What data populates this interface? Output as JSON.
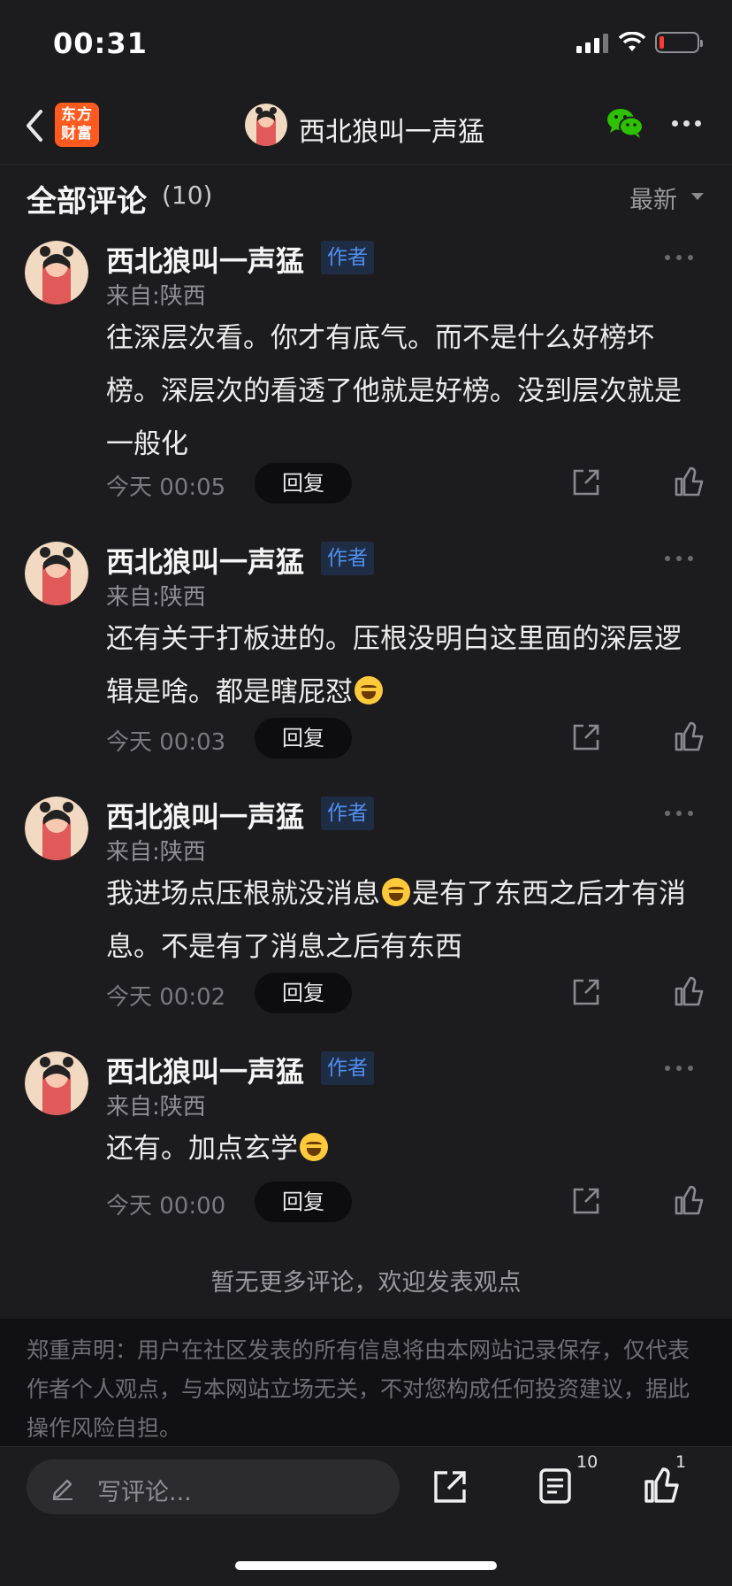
{
  "status_bar": {
    "time": "00:31",
    "battery_level": 0.12,
    "battery_color": "#ff3b30"
  },
  "nav": {
    "back_icon": "chevron-left-icon",
    "app_logo_line1": "东方",
    "app_logo_line2": "财富",
    "app_logo_color": "#ff5a1f",
    "title": "西北狼叫一声猛",
    "wechat_icon": "wechat-icon",
    "more_icon": "more-horizontal-icon"
  },
  "section": {
    "title": "全部评论",
    "count": "(10)",
    "sort_label": "最新"
  },
  "comments": [
    {
      "author": "西北狼叫一声猛",
      "badge": "作者",
      "location": "来自:陕西",
      "text": "往深层次看。你才有底气。而不是什么好榜坏榜。深层次的看透了他就是好榜。没到层次就是一般化",
      "time": "今天 00:05",
      "reply_label": "回复"
    },
    {
      "author": "西北狼叫一声猛",
      "badge": "作者",
      "location": "来自:陕西",
      "text_before": "还有关于打板进的。压根没明白这里面的深层逻辑是啥。都是瞎屁怼",
      "time": "今天 00:03",
      "reply_label": "回复"
    },
    {
      "author": "西北狼叫一声猛",
      "badge": "作者",
      "location": "来自:陕西",
      "text_before": "我进场点压根就没消息",
      "text_after": "是有了东西之后才有消息。不是有了消息之后有东西",
      "time": "今天 00:02",
      "reply_label": "回复"
    },
    {
      "author": "西北狼叫一声猛",
      "badge": "作者",
      "location": "来自:陕西",
      "text_before": "还有。加点玄学",
      "time": "今天 00:00",
      "reply_label": "回复"
    }
  ],
  "no_more": "暂无更多评论，欢迎发表观点",
  "disclaimer": "郑重声明：用户在社区发表的所有信息将由本网站记录保存，仅代表作者个人观点，与本网站立场无关，不对您构成任何投资建议，据此操作风险自担。",
  "bottom_bar": {
    "input_placeholder": "写评论...",
    "comment_count": "10",
    "like_count": "1"
  },
  "colors": {
    "background": "#1c1c1e",
    "badge_text": "#4f8ff0",
    "badge_bg": "#1f2d44"
  }
}
